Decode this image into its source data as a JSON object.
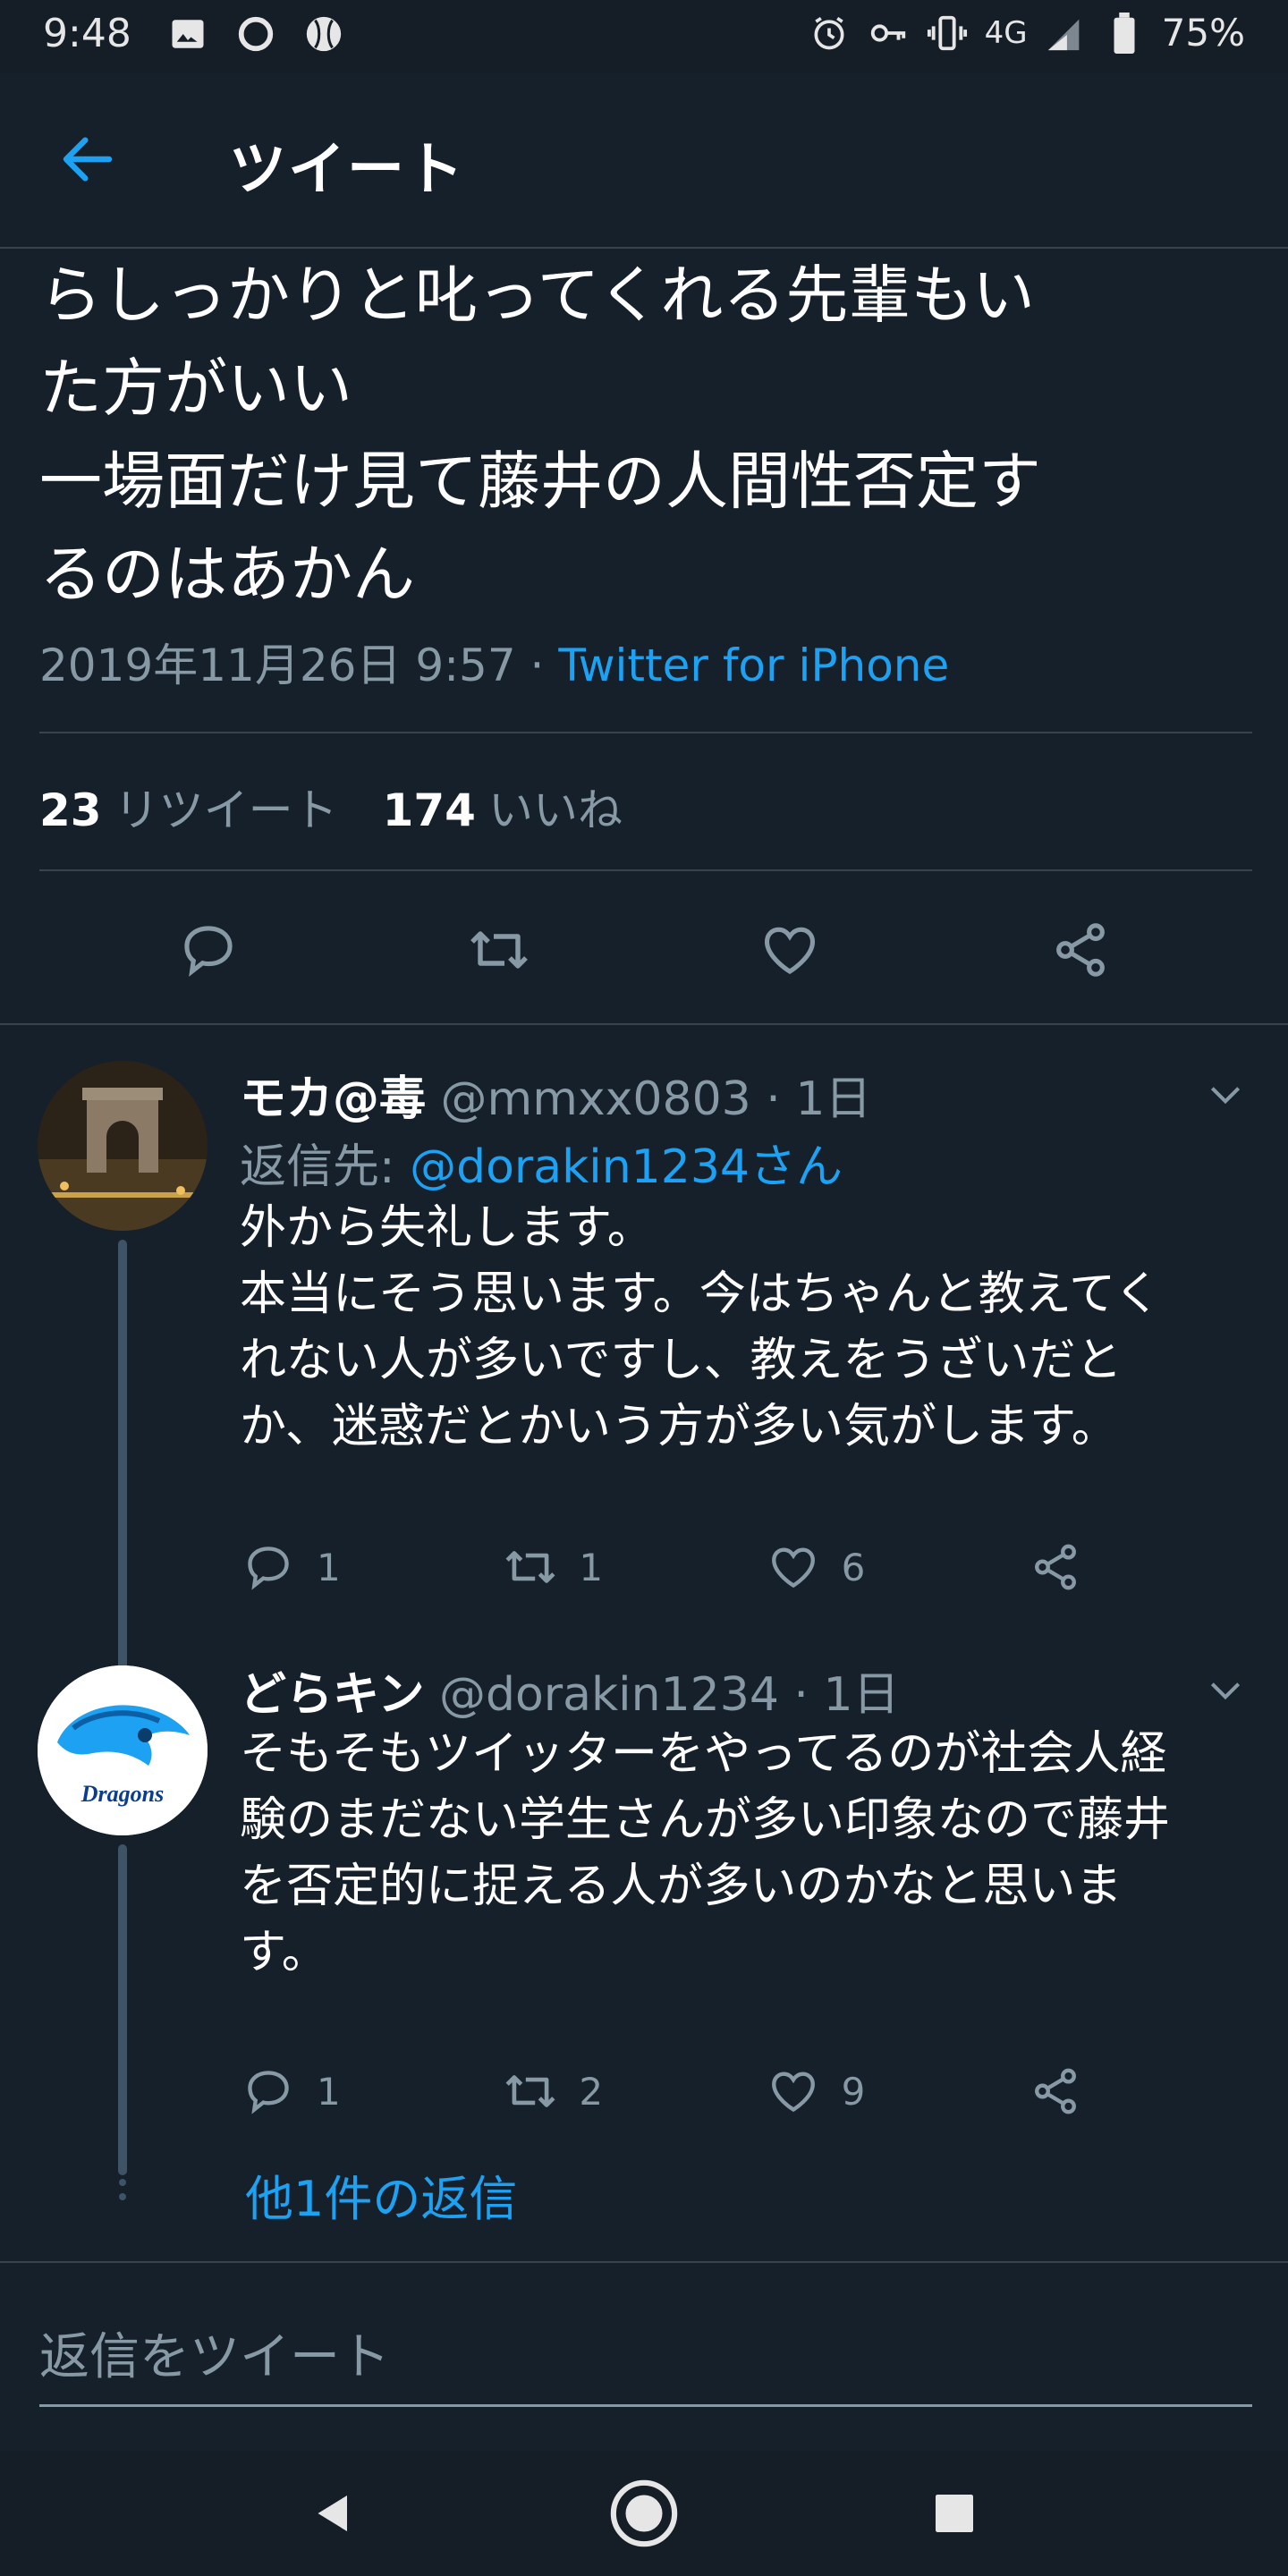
{
  "status_bar": {
    "time": "9:48",
    "network": "4G",
    "battery": "75%",
    "icons_left": [
      "image-icon",
      "circle-app-icon",
      "baseball-icon"
    ],
    "icons_right": [
      "alarm-icon",
      "key-icon",
      "vibrate-icon",
      "signal-icon",
      "battery-icon"
    ]
  },
  "header": {
    "title": "ツイート",
    "back_icon": "arrow-left-icon"
  },
  "tweet": {
    "text": "らしっかりと叱ってくれる先輩もい\nた方がいい\n一場面だけ見て藤井の人間性否定す\nるのはあかん",
    "date": "2019年11月26日 9:57 · ",
    "via": "Twitter for iPhone",
    "retweet_count": "23",
    "retweet_label": "リツイート",
    "like_count": "174",
    "like_label": "いいね"
  },
  "replies": [
    {
      "name": "モカ@毒",
      "handle": "@mmxx0803 · 1日",
      "reply_to_label": "返信先: ",
      "reply_to_user": "@dorakin1234さん",
      "text": "外から失礼します。\n本当にそう思います。今はちゃんと教えてく\nれない人が多いですし、教えをうざいだと\nか、迷惑だとかいう方が多い気がします。",
      "reply_count": "1",
      "retweet_count": "1",
      "like_count": "6"
    },
    {
      "name": "どらキン",
      "handle": "@dorakin1234 · 1日",
      "avatar_text": "Dragons",
      "text": "そもそもツイッターをやってるのが社会人経\n験のまだない学生さんが多い印象なので藤井\nを否定的に捉える人が多いのかなと思いま\nす。",
      "reply_count": "1",
      "retweet_count": "2",
      "like_count": "9"
    }
  ],
  "more_replies": "他1件の返信",
  "compose": {
    "placeholder": "返信をツイート"
  },
  "colors": {
    "background": "#15202b",
    "accent": "#1da1f2",
    "muted": "#8899a6",
    "divider": "#38444d"
  }
}
